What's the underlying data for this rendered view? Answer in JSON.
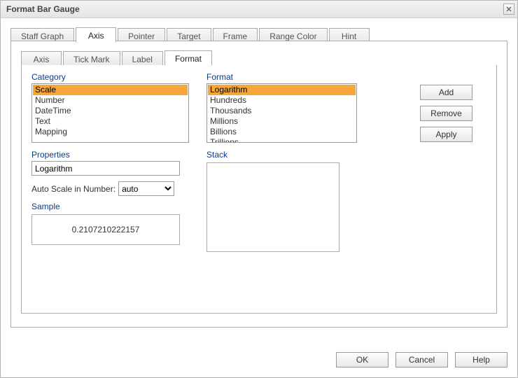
{
  "window": {
    "title": "Format Bar Gauge"
  },
  "tabs_primary": {
    "items": [
      "Staff Graph",
      "Axis",
      "Pointer",
      "Target",
      "Frame",
      "Range Color",
      "Hint"
    ],
    "active_index": 1
  },
  "tabs_secondary": {
    "items": [
      "Axis",
      "Tick Mark",
      "Label",
      "Format"
    ],
    "active_index": 3
  },
  "labels": {
    "category": "Category",
    "format": "Format",
    "properties": "Properties",
    "auto_scale": "Auto Scale in Number:",
    "sample": "Sample",
    "stack": "Stack"
  },
  "category_list": {
    "items": [
      "Scale",
      "Number",
      "DateTime",
      "Text",
      "Mapping"
    ],
    "selected_index": 0
  },
  "format_list": {
    "items": [
      "Logarithm",
      "Hundreds",
      "Thousands",
      "Millions",
      "Billions",
      "Trillions"
    ],
    "selected_index": 0
  },
  "properties_value": "Logarithm",
  "auto_scale_options": [
    "auto"
  ],
  "auto_scale_value": "auto",
  "sample_value": "0.2107210222157",
  "buttons": {
    "add": "Add",
    "remove": "Remove",
    "apply": "Apply",
    "ok": "OK",
    "cancel": "Cancel",
    "help": "Help"
  }
}
